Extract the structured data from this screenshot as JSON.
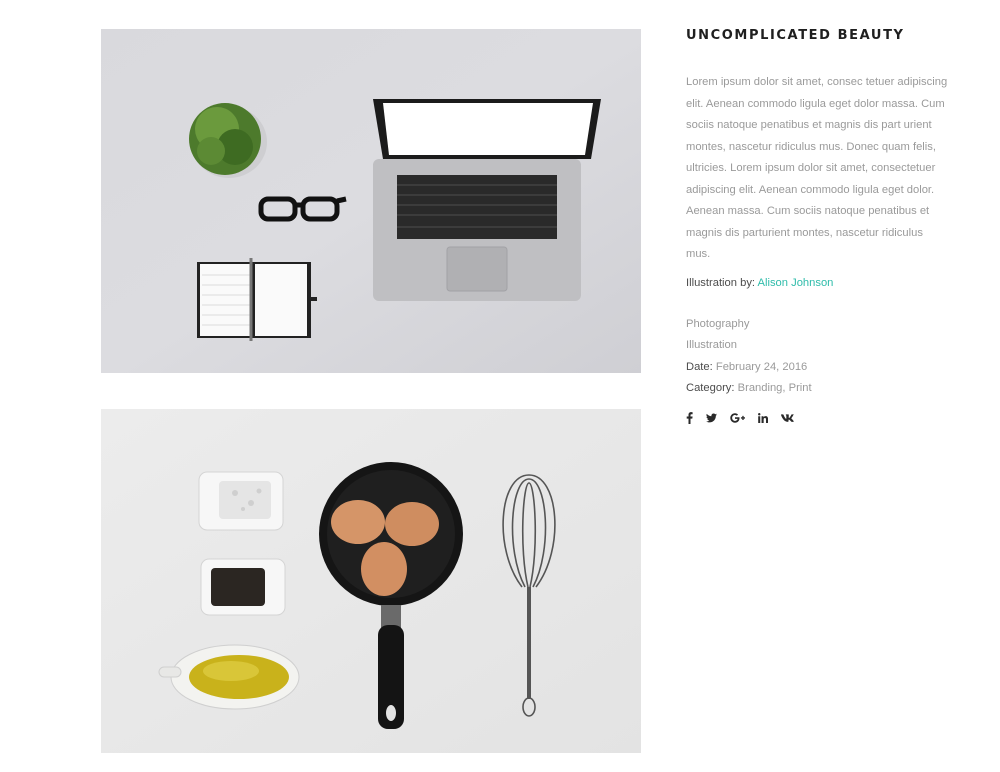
{
  "project": {
    "title": "UNCOMPLICATED BEAUTY",
    "description": "Lorem ipsum dolor sit amet, consec tetuer adipiscing elit. Aenean commodo ligula eget dolor massa. Cum sociis natoque penatibus et magnis dis part urient montes, nascetur ridiculus mus. Donec quam felis, ultricies. Lorem ipsum dolor sit amet, consectetuer adipiscing elit. Aenean commodo ligula eget dolor. Aenean massa. Cum sociis natoque penatibus et magnis dis parturient montes, nascetur ridiculus mus.",
    "credit_label": "Illustration by:",
    "credit_name": "Alison Johnson",
    "tags": [
      "Photography",
      "Illustration"
    ],
    "date_label": "Date:",
    "date_value": "February 24, 2016",
    "category_label": "Category:",
    "category_value": "Branding, Print"
  },
  "social": [
    {
      "name": "facebook-icon",
      "glyph": "f"
    },
    {
      "name": "twitter-icon",
      "glyph": "twitter"
    },
    {
      "name": "google-plus-icon",
      "glyph": "G+"
    },
    {
      "name": "linkedin-icon",
      "glyph": "in"
    },
    {
      "name": "vk-icon",
      "glyph": "vk"
    }
  ],
  "colors": {
    "accent": "#2fbcaa",
    "title": "#1f1f1f",
    "body_text": "#9a9a9a",
    "label_text": "#4c4c4c"
  },
  "images": [
    {
      "subject": "workspace-flatlay"
    },
    {
      "subject": "kitchen-flatlay"
    }
  ]
}
